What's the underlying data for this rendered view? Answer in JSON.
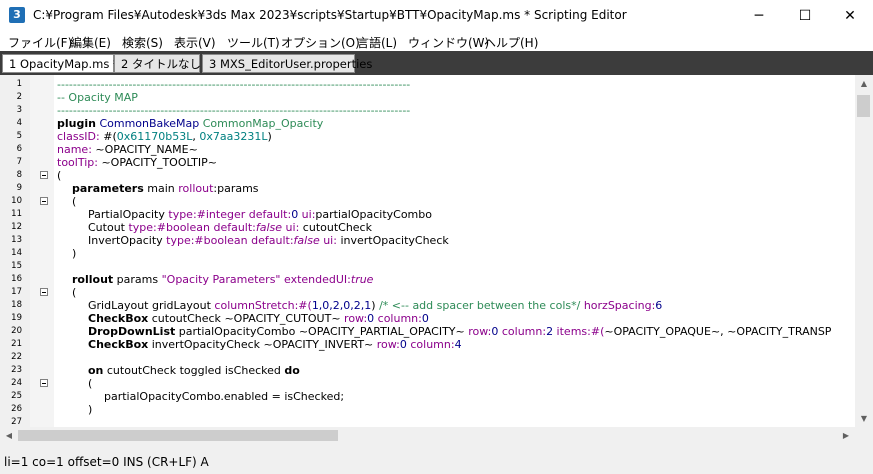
{
  "window": {
    "title": "C:¥Program Files¥Autodesk¥3ds Max 2023¥scripts¥Startup¥BTT¥OpacityMap.ms * Scripting Editor",
    "app_icon": "maxscript-editor-icon",
    "minimize": "─",
    "maximize": "☐",
    "close": "✕"
  },
  "menu": {
    "items": [
      "ファイル(F)",
      "編集(E)",
      "検索(S)",
      "表示(V)",
      "ツール(T)",
      "オプション(O)",
      "言語(L)",
      "ウィンドウ(W)",
      "ヘルプ(H)"
    ]
  },
  "tabs": [
    {
      "label": "1 OpacityMap.ms *",
      "active": true
    },
    {
      "label": "2 タイトルなし *",
      "active": false
    },
    {
      "label": "3 MXS_EditorUser.properties",
      "active": false
    }
  ],
  "editor": {
    "line_numbers": [
      "1",
      "2",
      "3",
      "4",
      "5",
      "6",
      "7",
      "8",
      "9",
      "10",
      "11",
      "12",
      "13",
      "14",
      "15",
      "16",
      "17",
      "18",
      "19",
      "20",
      "21",
      "22",
      "23",
      "24",
      "25",
      "26",
      "27"
    ],
    "lines": {
      "l1": "-----------------------------------------------------------------------------------------",
      "l2": "-- Opacity MAP",
      "l3": "-----------------------------------------------------------------------------------------",
      "l4a": "plugin",
      "l4b": " CommonBakeMap",
      "l4c": " CommonMap_Opacity",
      "l5a": "classID:",
      "l5b": " #(",
      "l5c": "0x61170b53L",
      "l5d": ",",
      "l5e": " 0x7aa3231L",
      "l5f": ")",
      "l6a": "name:",
      "l6b": " ~OPACITY_NAME~",
      "l7a": "toolTip:",
      "l7b": " ~OPACITY_TOOLTIP~",
      "l8": "(",
      "l9a": "parameters",
      "l9b": " main ",
      "l9c": "rollout",
      "l9d": ":params",
      "l10": "(",
      "l11a": "PartialOpacity ",
      "l11b": "type:#integer",
      "l11c": " default:",
      "l11d": "0",
      "l11e": " ui:",
      "l11f": "partialOpacityCombo",
      "l12a": "Cutout ",
      "l12b": "type:#boolean",
      "l12c": " default:",
      "l12d": "false",
      "l12e": " ui:",
      "l12f": " cutoutCheck",
      "l13a": "InvertOpacity ",
      "l13b": "type:#boolean",
      "l13c": " default:",
      "l13d": "false",
      "l13e": " ui:",
      "l13f": " invertOpacityCheck",
      "l14": ")",
      "l16a": "rollout",
      "l16b": " params ",
      "l16c": "\"Opacity Parameters\"",
      "l16d": " extendedUI:",
      "l16e": "true",
      "l17": "(",
      "l18a": "GridLayout gridLayout ",
      "l18b": "columnStretch:#(",
      "l18c": "1,0,2,0,2,1",
      "l18d": ")",
      "l18e": " /* <-- add spacer between the cols*/ ",
      "l18f": "horzSpacing:",
      "l18g": "6",
      "l19a": "CheckBox",
      "l19b": " cutoutCheck ",
      "l19c": "~OPACITY_CUTOUT~",
      "l19d": " row:",
      "l19e": "0",
      "l19f": " column:",
      "l19g": "0",
      "l20a": "DropDownList",
      "l20b": " partialOpacityCombo ",
      "l20c": "~OPACITY_PARTIAL_OPACITY~",
      "l20d": " row:",
      "l20e": "0",
      "l20f": " column:",
      "l20g": "2",
      "l20h": " items:#(",
      "l20i": "~OPACITY_OPAQUE~, ~OPACITY_TRANSP",
      "l21a": "CheckBox",
      "l21b": " invertOpacityCheck ",
      "l21c": "~OPACITY_INVERT~",
      "l21d": " row:",
      "l21e": "0",
      "l21f": " column:",
      "l21g": "4",
      "l23a": "on",
      "l23b": " cutoutCheck toggled isChecked ",
      "l23c": "do",
      "l24": "(",
      "l25": "partialOpacityCombo.enabled = isChecked;",
      "l26": ")"
    }
  },
  "statusbar": {
    "text": "li=1 co=1 offset=0 INS (CR+LF) A"
  },
  "scroll_arrows": {
    "up": "▲",
    "down": "▼",
    "left": "◀",
    "right": "▶"
  }
}
